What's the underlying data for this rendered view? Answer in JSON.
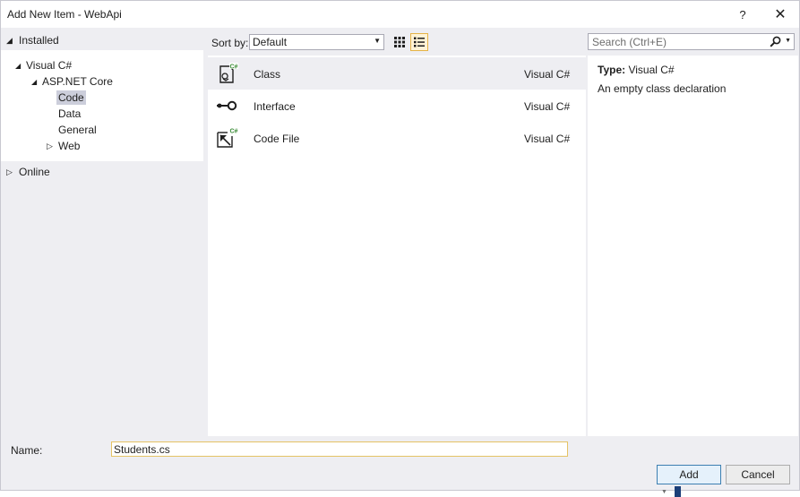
{
  "window": {
    "title": "Add New Item - WebApi",
    "help_glyph": "?",
    "close_glyph": "✕"
  },
  "tree": {
    "installed": {
      "label": "Installed",
      "expanded": true
    },
    "items": [
      {
        "label": "Visual C#",
        "expanded": true
      },
      {
        "label": "ASP.NET Core",
        "expanded": true
      },
      {
        "label": "Code",
        "selected": true
      },
      {
        "label": "Data"
      },
      {
        "label": "General"
      },
      {
        "label": "Web",
        "expanded": false
      }
    ],
    "online": {
      "label": "Online",
      "expanded": false
    }
  },
  "toolbar": {
    "sort_label": "Sort by:",
    "sort_value": "Default",
    "search_placeholder": "Search (Ctrl+E)",
    "view_mode": "list"
  },
  "templates": [
    {
      "name": "Class",
      "language": "Visual C#",
      "icon": "csharp-class-icon",
      "selected": true
    },
    {
      "name": "Interface",
      "language": "Visual C#",
      "icon": "interface-icon",
      "selected": false
    },
    {
      "name": "Code File",
      "language": "Visual C#",
      "icon": "csharp-code-file-icon",
      "selected": false
    }
  ],
  "details": {
    "type_label": "Type:",
    "type_value": "Visual C#",
    "description": "An empty class declaration"
  },
  "footer": {
    "name_label": "Name:",
    "name_value": "Students.cs",
    "add_label": "Add",
    "cancel_label": "Cancel"
  },
  "colors": {
    "accent_green": "#388a34",
    "selection_gray": "#cccedb",
    "focus_border": "#e5c365",
    "primary_button_border": "#3c7fb1"
  }
}
